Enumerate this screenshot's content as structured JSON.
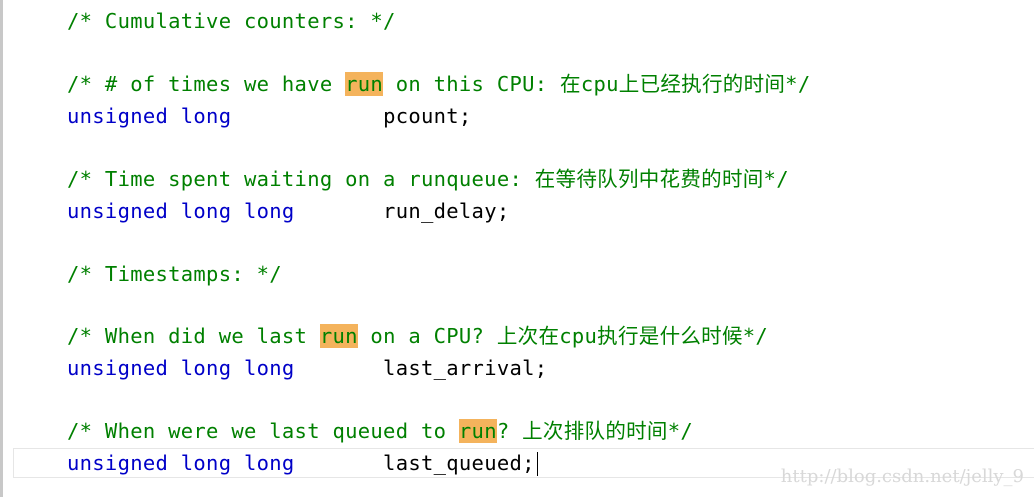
{
  "top_fragment": "_      _",
  "code_lines": [
    [
      {
        "t": "/* Cumulative counters: */",
        "s": "comment"
      }
    ],
    [
      {
        "t": "/* # of times we have ",
        "s": "comment"
      },
      {
        "t": "run",
        "s": "comment hl"
      },
      {
        "t": " on this CPU: 在cpu上已经执行的时间*/",
        "s": "comment"
      }
    ],
    [
      {
        "t": "unsigned long",
        "s": "kw"
      },
      {
        "t": "            pcount;",
        "s": "plain"
      }
    ],
    [
      {
        "t": "/* Time spent waiting on a runqueue: 在等待队列中花费的时间*/",
        "s": "comment"
      }
    ],
    [
      {
        "t": "unsigned long long",
        "s": "kw"
      },
      {
        "t": "       run_delay;",
        "s": "plain"
      }
    ],
    [
      {
        "t": "/* Timestamps: */",
        "s": "comment"
      }
    ],
    [
      {
        "t": "/* When did we last ",
        "s": "comment"
      },
      {
        "t": "run",
        "s": "comment hl"
      },
      {
        "t": " on a CPU? 上次在cpu执行是什么时候*/",
        "s": "comment"
      }
    ],
    [
      {
        "t": "unsigned long long",
        "s": "kw"
      },
      {
        "t": "       last_arrival;",
        "s": "plain"
      }
    ],
    [
      {
        "t": "/* When were we last queued to ",
        "s": "comment"
      },
      {
        "t": "run",
        "s": "comment hl"
      },
      {
        "t": "? 上次排队的时间*/",
        "s": "comment"
      }
    ],
    [
      {
        "t": "unsigned long long",
        "s": "kw"
      },
      {
        "t": "       last_queued;",
        "s": "plain"
      }
    ]
  ],
  "watermark": "http://blog.csdn.net/jelly_9"
}
